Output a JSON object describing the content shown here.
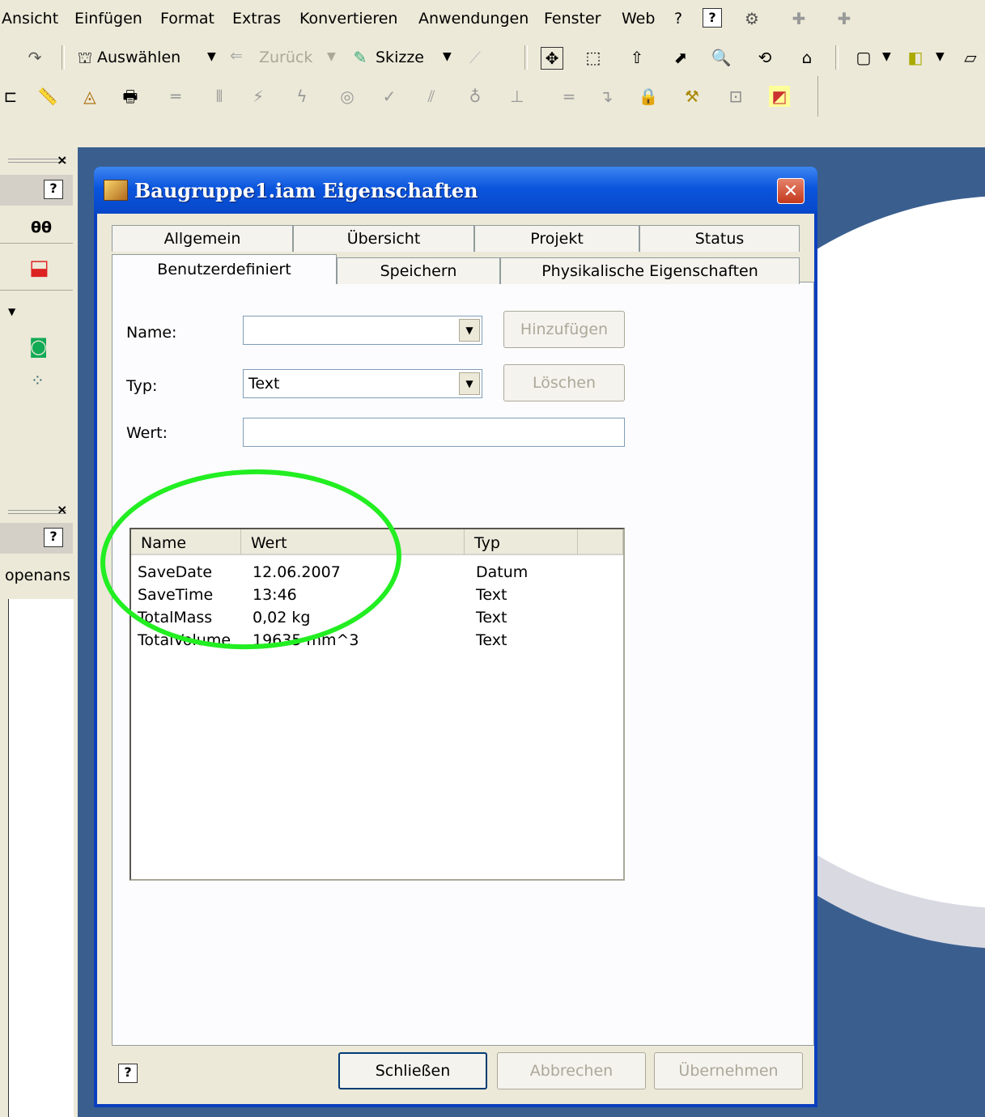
{
  "menubar": {
    "items": [
      "Ansicht",
      "Einfügen",
      "Format",
      "Extras",
      "Konvertieren",
      "Anwendungen",
      "Fenster",
      "Web",
      "?"
    ]
  },
  "toolbar": {
    "select_label": "Auswählen",
    "back_label": "Zurück",
    "sketch_label": "Skizze"
  },
  "leftpanel": {
    "browser_label": "openans"
  },
  "dialog": {
    "title": "Baugruppe1.iam Eigenschaften",
    "tabs_row1": [
      "Allgemein",
      "Übersicht",
      "Projekt",
      "Status"
    ],
    "tabs_row2": [
      "Benutzerdefiniert",
      "Speichern",
      "Physikalische Eigenschaften"
    ],
    "active_tab": "Benutzerdefiniert",
    "name_label": "Name:",
    "name_value": "",
    "type_label": "Typ:",
    "type_value": "Text",
    "value_label": "Wert:",
    "value_value": "",
    "add_button": "Hinzufügen",
    "delete_button": "Löschen",
    "columns": [
      "Name",
      "Wert",
      "Typ"
    ],
    "rows": [
      {
        "name": "SaveDate",
        "wert": "12.06.2007",
        "typ": "Datum"
      },
      {
        "name": "SaveTime",
        "wert": "13:46",
        "typ": "Text"
      },
      {
        "name": "TotalMass",
        "wert": "0,02 kg",
        "typ": "Text"
      },
      {
        "name": "TotalVolume",
        "wert": "19635 mm^3",
        "typ": "Text"
      }
    ],
    "close_button": "Schließen",
    "cancel_button": "Abbrechen",
    "apply_button": "Übernehmen",
    "help_icon": "?"
  },
  "colors": {
    "viewport_bg": "#3a5f8f",
    "highlight_ellipse": "#22ee22",
    "titlebar": "#0b55dd"
  }
}
